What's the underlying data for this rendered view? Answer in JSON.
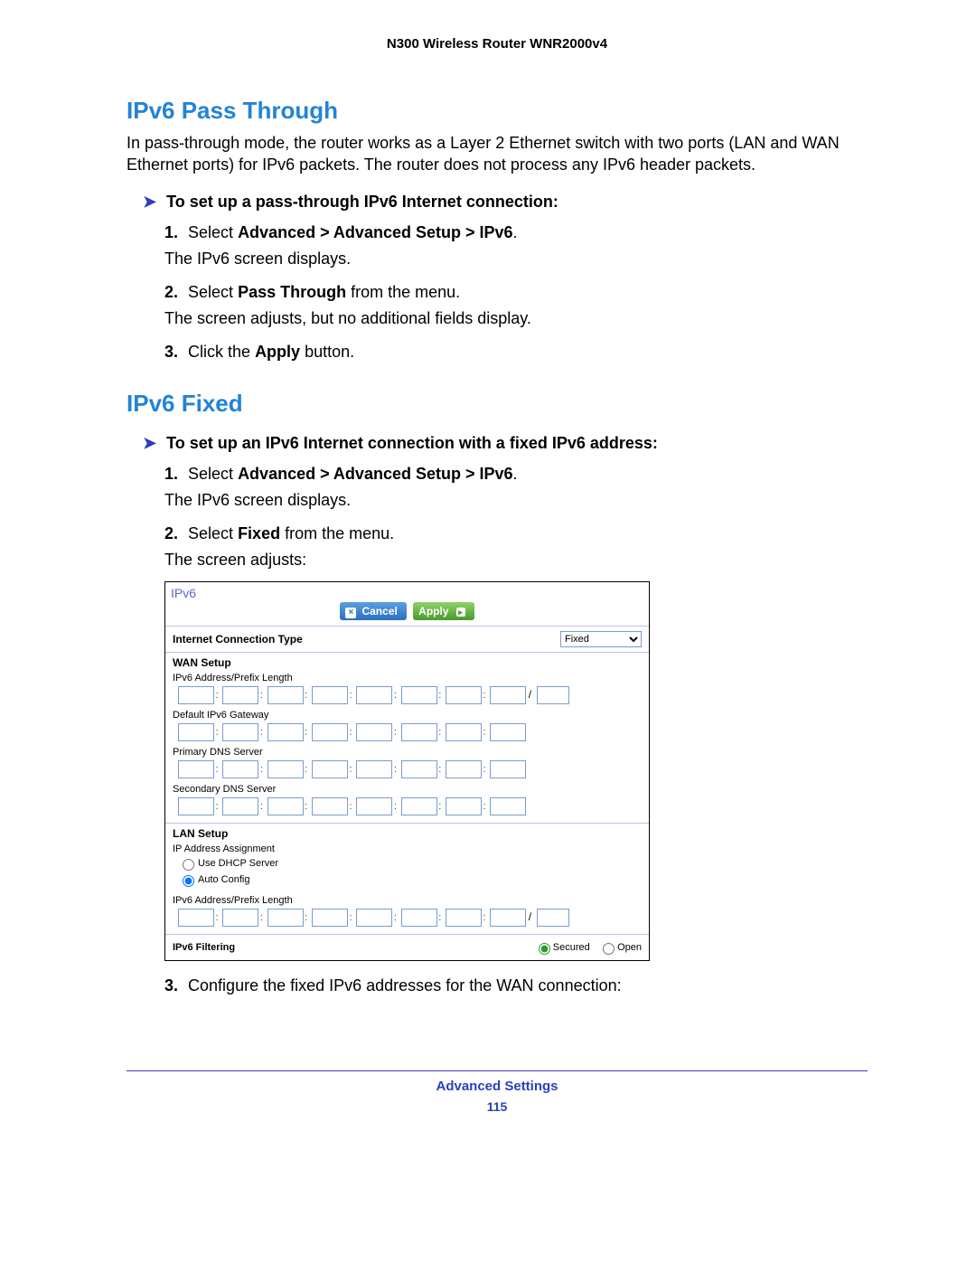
{
  "header": {
    "title": "N300 Wireless Router WNR2000v4"
  },
  "section1": {
    "heading": "IPv6 Pass Through",
    "intro": "In pass-through mode, the router works as a Layer 2 Ethernet switch with two ports (LAN and WAN Ethernet ports) for IPv6 packets. The router does not process any IPv6 header packets.",
    "task": "To set up a pass-through IPv6 Internet connection:",
    "steps": {
      "s1a": "Select ",
      "s1b": "Advanced > Advanced Setup > IPv6",
      "s1c": ".",
      "s1sub": "The IPv6 screen displays.",
      "s2a": "Select ",
      "s2b": "Pass Through",
      "s2c": " from the menu.",
      "s2sub": "The screen adjusts, but no additional fields display.",
      "s3a": "Click the ",
      "s3b": "Apply",
      "s3c": " button."
    }
  },
  "section2": {
    "heading": "IPv6 Fixed",
    "task": "To set up an IPv6 Internet connection with a fixed IPv6 address:",
    "steps": {
      "s1a": "Select ",
      "s1b": "Advanced > Advanced Setup > IPv6",
      "s1c": ".",
      "s1sub": "The IPv6 screen displays.",
      "s2a": "Select ",
      "s2b": "Fixed",
      "s2c": " from the menu.",
      "s2sub": "The screen adjusts:",
      "s3": "Configure the fixed IPv6 addresses for the WAN connection:"
    }
  },
  "ui": {
    "title": "IPv6",
    "cancel": "Cancel",
    "apply": "Apply",
    "conn_type_label": "Internet Connection Type",
    "conn_type_value": "Fixed",
    "wan_setup": "WAN Setup",
    "ipv6_addr_prefix": "IPv6 Address/Prefix Length",
    "default_gateway": "Default IPv6 Gateway",
    "primary_dns": "Primary DNS Server",
    "secondary_dns": "Secondary DNS Server",
    "lan_setup": "LAN Setup",
    "ip_assignment": "IP Address Assignment",
    "use_dhcp": "Use DHCP Server",
    "auto_config": "Auto Config",
    "lan_ipv6_addr_prefix": "IPv6 Address/Prefix Length",
    "ipv6_filtering": "IPv6 Filtering",
    "secured": "Secured",
    "open": "Open"
  },
  "footer": {
    "label": "Advanced Settings",
    "page": "115"
  }
}
